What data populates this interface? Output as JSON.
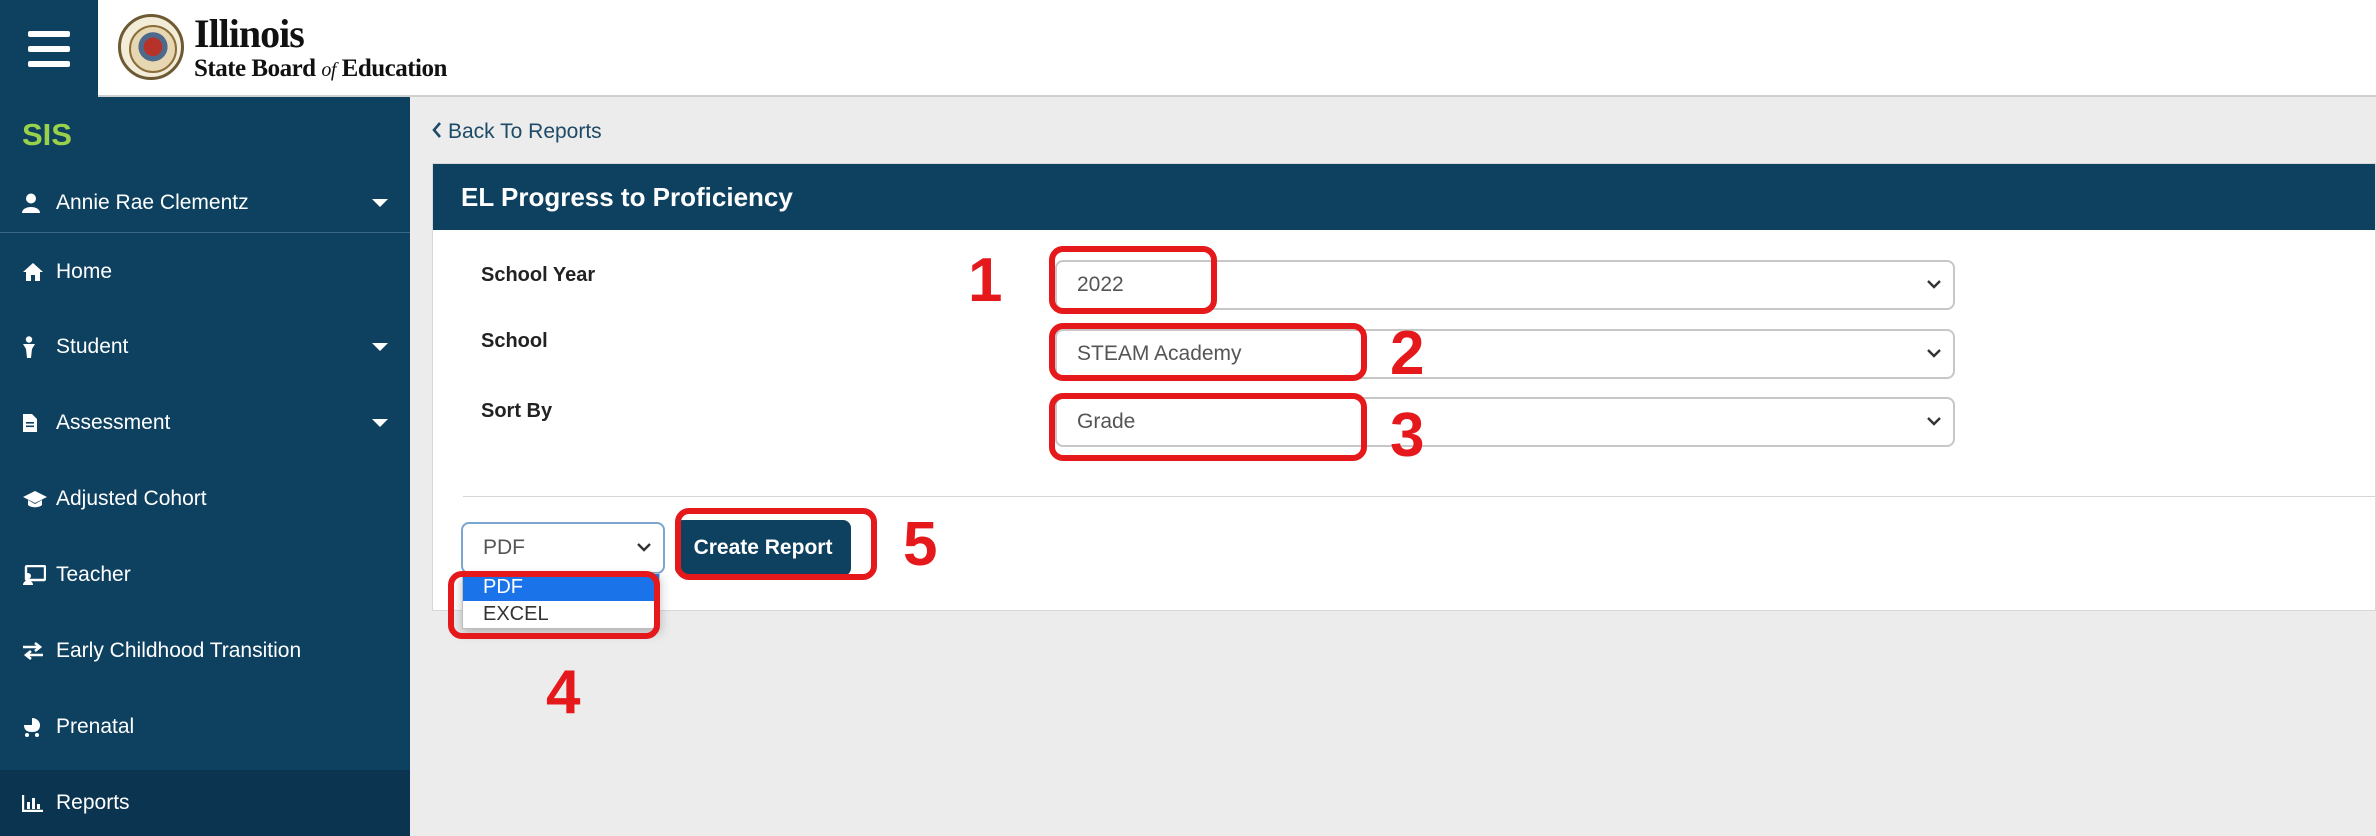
{
  "header": {
    "logo_line1": "Illinois",
    "logo_line2_a": "State Board",
    "logo_line2_of": "of",
    "logo_line2_b": "Education"
  },
  "sidebar": {
    "app_name": "SIS",
    "user_name": "Annie Rae Clementz",
    "items": [
      {
        "label": "Home",
        "icon": "home-icon"
      },
      {
        "label": "Student",
        "icon": "student-icon"
      },
      {
        "label": "Assessment",
        "icon": "document-icon"
      },
      {
        "label": "Adjusted Cohort",
        "icon": "graduation-cap-icon"
      },
      {
        "label": "Teacher",
        "icon": "chalkboard-icon"
      },
      {
        "label": "Early Childhood Transition",
        "icon": "arrows-exchange-icon"
      },
      {
        "label": "Prenatal",
        "icon": "baby-carriage-icon"
      },
      {
        "label": "Reports",
        "icon": "bar-chart-icon"
      }
    ]
  },
  "main": {
    "back_link": "Back To Reports",
    "panel_title": "EL Progress to Proficiency",
    "fields": {
      "school_year_label": "School Year",
      "school_year_value": "2022",
      "school_label": "School",
      "school_value": "STEAM Academy",
      "sort_by_label": "Sort By",
      "sort_by_value": "Grade"
    },
    "format_value": "PDF",
    "format_options": [
      "PDF",
      "EXCEL"
    ],
    "create_button": "Create Report"
  },
  "annotations": {
    "color": "#e5191c",
    "labels": [
      "1",
      "2",
      "3",
      "4",
      "5"
    ]
  },
  "colors": {
    "navy": "#0e4060",
    "sis_green": "#9ad14a"
  }
}
